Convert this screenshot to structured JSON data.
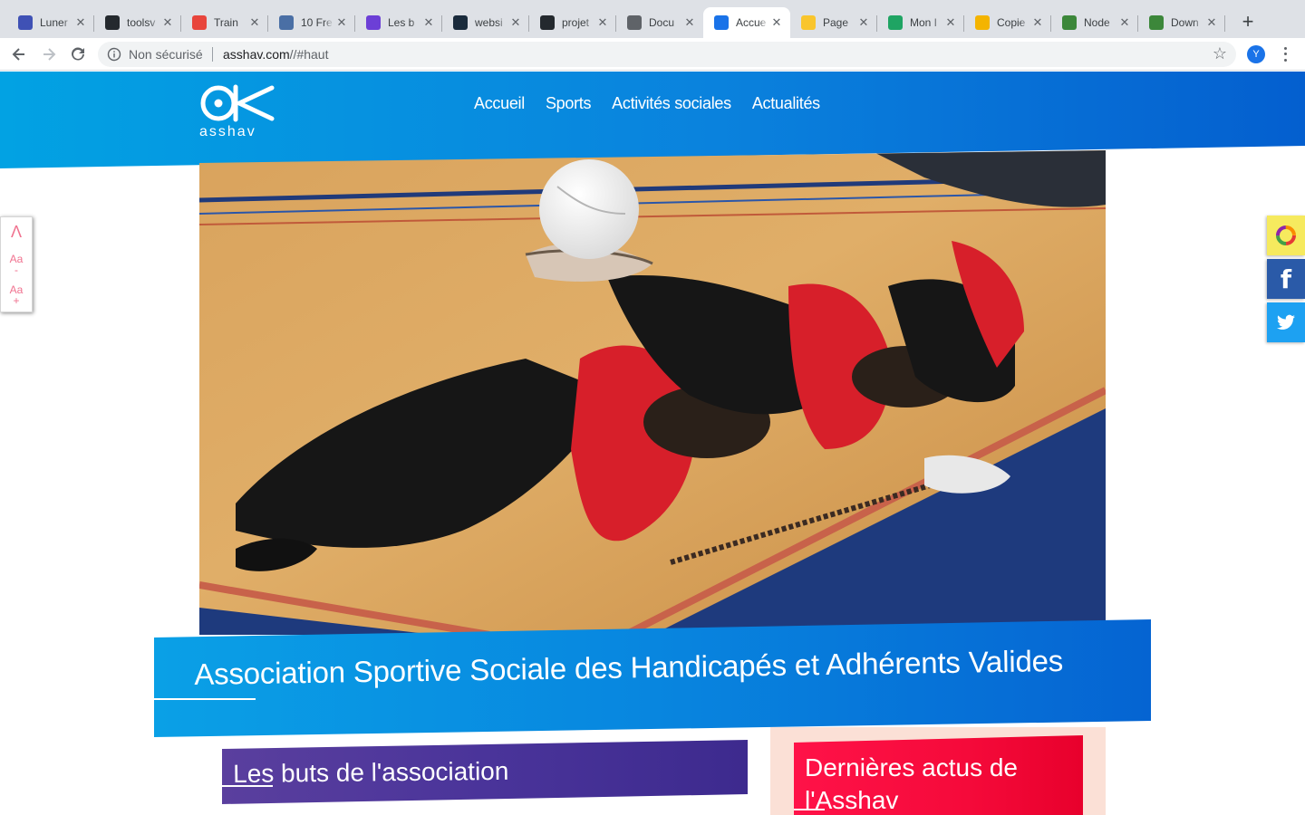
{
  "browser": {
    "tabs": [
      {
        "title": "Luner",
        "favicon": "calendar-favicon",
        "color": "#3f51b5"
      },
      {
        "title": "toolsv",
        "favicon": "github-favicon",
        "color": "#24292e"
      },
      {
        "title": "Train",
        "favicon": "training-favicon",
        "color": "#e8453c"
      },
      {
        "title": "10 Fre",
        "favicon": "bo-favicon",
        "color": "#4a6fa5"
      },
      {
        "title": "Les b",
        "favicon": "purple-d-favicon",
        "color": "#6c3fd6"
      },
      {
        "title": "websi",
        "favicon": "website-favicon",
        "color": "#1a2b3c"
      },
      {
        "title": "projet",
        "favicon": "github-favicon",
        "color": "#24292e"
      },
      {
        "title": "Docu",
        "favicon": "globe-favicon",
        "color": "#5f6368"
      },
      {
        "title": "Accue",
        "favicon": "asshav-favicon",
        "color": "#1a73e8"
      },
      {
        "title": "Page",
        "favicon": "accessibility-favicon",
        "color": "#f9c52d"
      },
      {
        "title": "Mon I",
        "favicon": "drive-favicon",
        "color": "#1fa463"
      },
      {
        "title": "Copie",
        "favicon": "slides-favicon",
        "color": "#f4b400"
      },
      {
        "title": "Node",
        "favicon": "node-favicon",
        "color": "#3c873a"
      },
      {
        "title": "Down",
        "favicon": "node-favicon",
        "color": "#3c873a"
      }
    ],
    "active_tab_index": 8,
    "address": {
      "security_label": "Non sécurisé",
      "host": "asshav.com",
      "path": "//#haut"
    },
    "profile_initial": "Y"
  },
  "site": {
    "logo_text": "asshav",
    "nav": [
      "Accueil",
      "Sports",
      "Activités sociales",
      "Actualités"
    ],
    "banner_title": "Association Sportive Sociale des Handicapés et Adhérents Valides",
    "section_goals_title": "Les buts de l'association",
    "news_title": "Dernières actus de l'Asshav",
    "a11y": {
      "top_label": "Λ",
      "decrease_label": "Aa",
      "increase_label": "Aa"
    }
  },
  "colors": {
    "header_blue": "#0a82dd",
    "banner_blue": "#0886df",
    "goals_purple": "#4a349a",
    "news_red": "#f50a3a",
    "news_panel": "#fbe0d6",
    "facebook": "#2a5aa8",
    "twitter": "#1da1f2",
    "a11y_pink": "#f0728f"
  }
}
